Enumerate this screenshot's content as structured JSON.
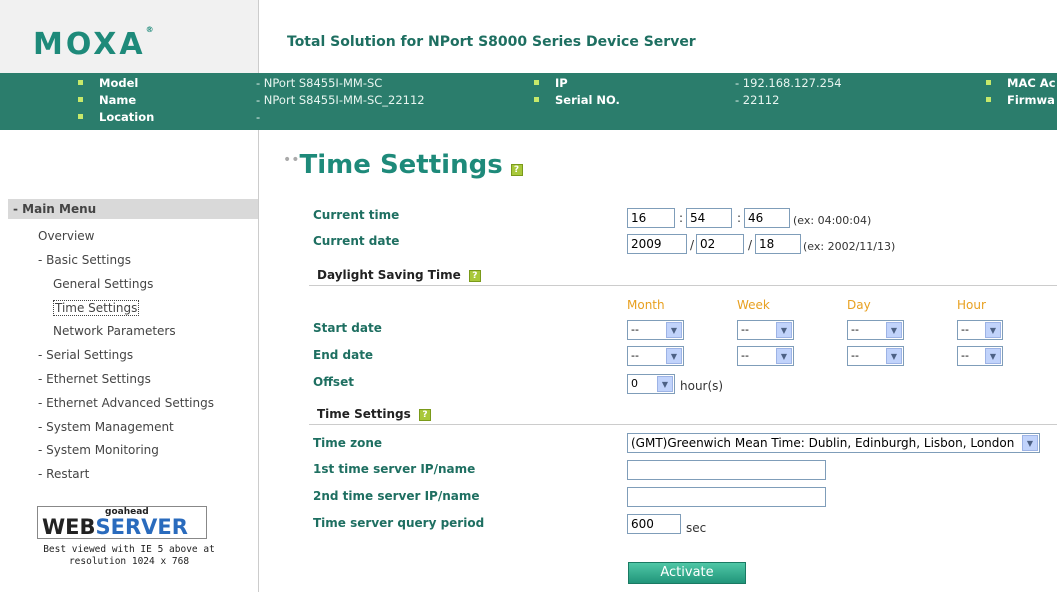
{
  "header": {
    "logo": "MOXA",
    "logo_reg": "®",
    "title": "Total Solution for NPort S8000 Series Device Server",
    "info": {
      "model_label": "Model",
      "model_value": "- NPort S8455I-MM-SC",
      "name_label": "Name",
      "name_value": "- NPort S8455I-MM-SC_22112",
      "location_label": "Location",
      "location_value": "-",
      "ip_label": "IP",
      "ip_value": "- 192.168.127.254",
      "serial_label": "Serial NO.",
      "serial_value": "- 22112",
      "mac_label": "MAC Ac",
      "firmware_label": "Firmwa"
    }
  },
  "sidebar": {
    "header": "- Main Menu",
    "items": [
      "Overview",
      "- Basic Settings",
      "General Settings",
      "Time Settings",
      "Network Parameters",
      "- Serial Settings",
      "- Ethernet Settings",
      "- Ethernet Advanced Settings",
      "- System Management",
      "- System Monitoring",
      "- Restart"
    ],
    "webserver_small": "goahead",
    "webserver_web": "WEB",
    "webserver_server": "SERVER",
    "best_viewed": "Best viewed with IE 5 above at",
    "resolution": "resolution 1024 x 768"
  },
  "page": {
    "title": "Time Settings",
    "current_time_label": "Current time",
    "current_time": {
      "h": "16",
      "m": "54",
      "s": "46",
      "example": "(ex: 04:00:04)"
    },
    "current_date_label": "Current date",
    "current_date": {
      "y": "2009",
      "mo": "02",
      "d": "18",
      "example": "(ex: 2002/11/13)"
    },
    "dst_section": "Daylight Saving Time",
    "columns": [
      "Month",
      "Week",
      "Day",
      "Hour"
    ],
    "start_date_label": "Start date",
    "end_date_label": "End date",
    "dash_option": "--",
    "offset_label": "Offset",
    "offset_value": "0",
    "offset_unit": "hour(s)",
    "time_section": "Time Settings",
    "timezone_label": "Time zone",
    "timezone_value": "(GMT)Greenwich Mean Time: Dublin, Edinburgh, Lisbon, London",
    "server1_label": "1st time server IP/name",
    "server1_value": "",
    "server2_label": "2nd time server IP/name",
    "server2_value": "",
    "query_label": "Time server query period",
    "query_value": "600",
    "query_unit": "sec",
    "activate": "Activate",
    "colon": ":",
    "slash": "/",
    "help": "?"
  }
}
